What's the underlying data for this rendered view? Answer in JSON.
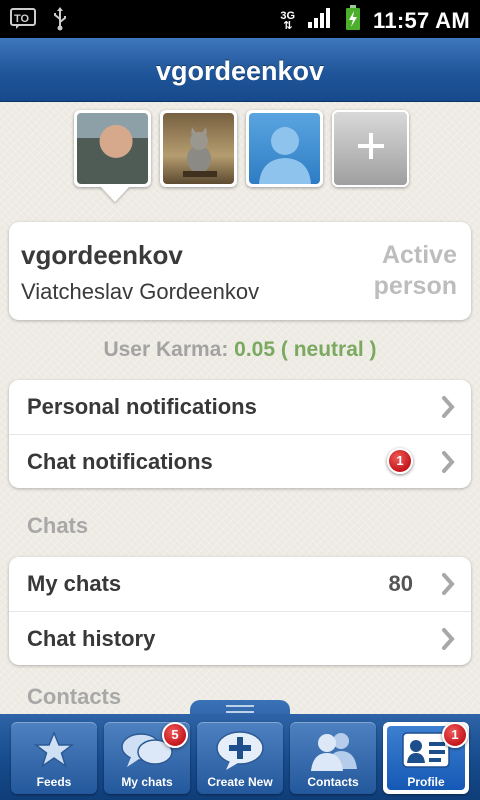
{
  "status_bar": {
    "time": "11:57 AM",
    "network": "3G"
  },
  "header": {
    "title": "vgordeenkov"
  },
  "avatars": [
    {
      "name": "profile-photo"
    },
    {
      "name": "cat-photo"
    },
    {
      "name": "placeholder-photo"
    }
  ],
  "profile": {
    "username": "vgordeenkov",
    "full_name": "Viatcheslav Gordeenkov",
    "status_line1": "Active",
    "status_line2": "person"
  },
  "karma": {
    "label": "User Karma: ",
    "value": "0.05 ( neutral )"
  },
  "notifications": [
    {
      "label": "Personal notifications"
    },
    {
      "label": "Chat notifications",
      "badge": "1"
    }
  ],
  "chats_section": {
    "title": "Chats",
    "items": [
      {
        "label": "My chats",
        "count": "80"
      },
      {
        "label": "Chat history"
      }
    ]
  },
  "contacts_section": {
    "title": "Contacts"
  },
  "tabs": [
    {
      "label": "Feeds",
      "icon": "star-icon"
    },
    {
      "label": "My chats",
      "icon": "chat-bubbles-icon",
      "badge": "5"
    },
    {
      "label": "Create New",
      "icon": "plus-bubble-icon"
    },
    {
      "label": "Contacts",
      "icon": "people-icon"
    },
    {
      "label": "Profile",
      "icon": "id-card-icon",
      "badge": "1",
      "active": true
    }
  ],
  "colors": {
    "brand_blue": "#1f5599",
    "karma_green": "#7aa95f",
    "badge_red": "#c4161c"
  }
}
